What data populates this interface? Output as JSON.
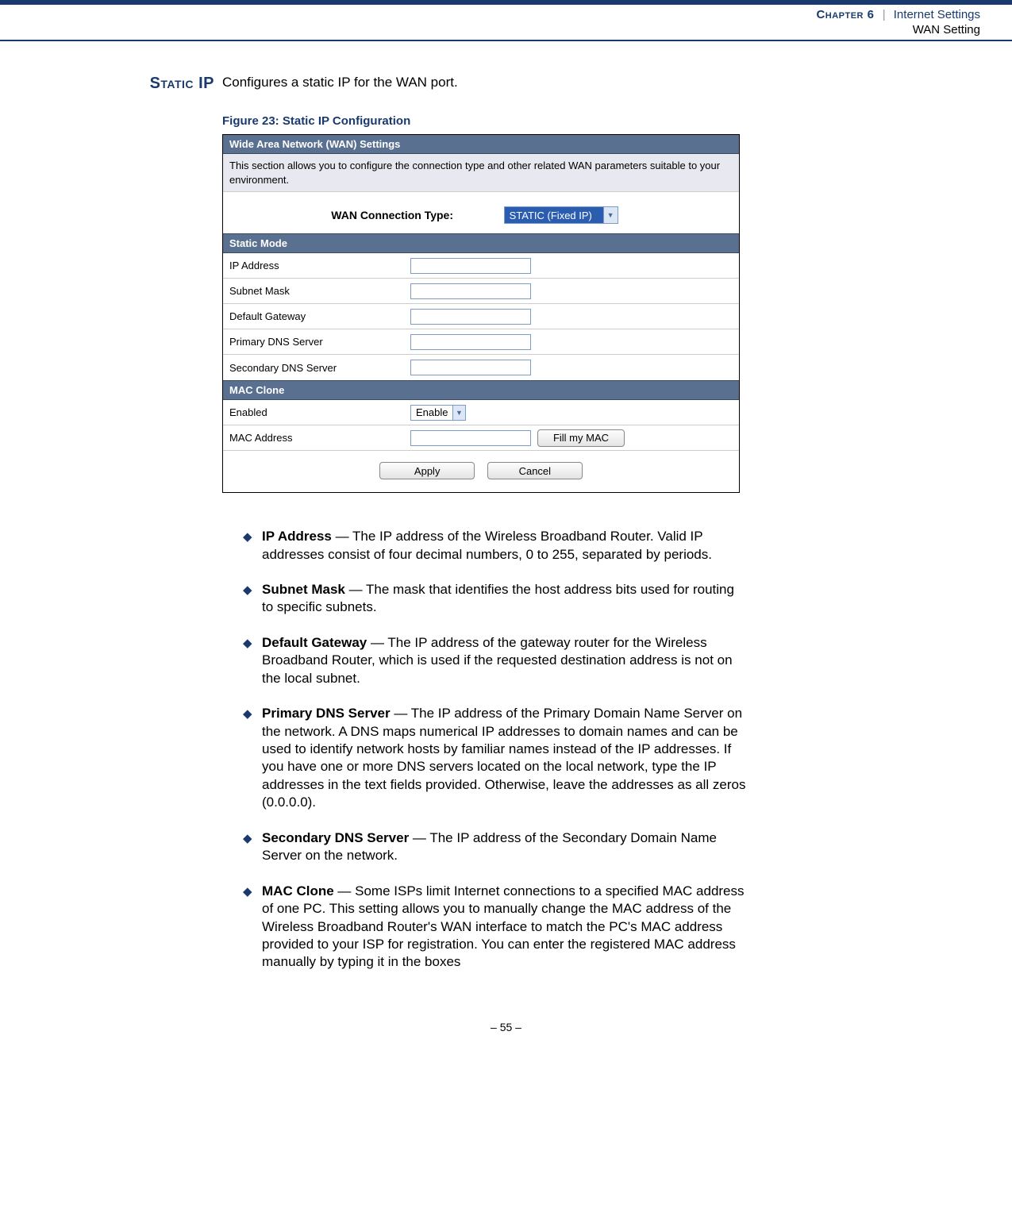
{
  "header": {
    "chapter": "Chapter 6",
    "separator": "|",
    "title": "Internet Settings",
    "subtitle": "WAN Setting"
  },
  "section": {
    "label": "Static IP",
    "lead": "Configures a static IP for the WAN port."
  },
  "figure": {
    "caption": "Figure 23:  Static IP Configuration",
    "panel_title": "Wide Area Network (WAN) Settings",
    "panel_desc": "This section allows you to configure the connection type and other related WAN parameters suitable to your environment.",
    "conn_label": "WAN Connection Type:",
    "conn_value": "STATIC (Fixed IP)",
    "static_mode_header": "Static Mode",
    "rows": {
      "ip_address": "IP Address",
      "subnet_mask": "Subnet Mask",
      "default_gateway": "Default Gateway",
      "primary_dns": "Primary DNS Server",
      "secondary_dns": "Secondary DNS Server"
    },
    "mac_clone_header": "MAC Clone",
    "mac_enabled_label": "Enabled",
    "mac_enabled_value": "Enable",
    "mac_address_label": "MAC Address",
    "fill_my_mac": "Fill my MAC",
    "apply": "Apply",
    "cancel": "Cancel"
  },
  "bullets": [
    {
      "term": "IP Address",
      "desc": " — The IP address of the Wireless Broadband Router. Valid IP addresses consist of four decimal numbers, 0 to 255, separated by periods."
    },
    {
      "term": "Subnet Mask",
      "desc": " — The mask that identifies the host address bits used for routing to specific subnets."
    },
    {
      "term": "Default Gateway",
      "desc": " — The IP address of the gateway router for the Wireless Broadband Router, which is used if the requested destination address is not on the local subnet."
    },
    {
      "term": "Primary DNS Server",
      "desc": " — The IP address of the Primary Domain Name Server on the network. A DNS maps numerical IP addresses to domain names and can be used to identify network hosts by familiar names instead of the IP addresses. If you have one or more DNS servers located on the local network, type the IP addresses in the text fields provided. Otherwise, leave the addresses as all zeros (0.0.0.0)."
    },
    {
      "term": "Secondary DNS Server",
      "desc": " — The IP address of the Secondary Domain Name Server on the network."
    },
    {
      "term": "MAC Clone",
      "desc": " — Some ISPs limit Internet connections to a specified MAC address of one PC. This setting allows you to manually change the MAC address of the Wireless Broadband Router's WAN interface to match the PC's MAC address provided to your ISP for registration. You can enter the registered MAC address manually by typing it in the boxes"
    }
  ],
  "footer": {
    "page": "–  55  –"
  }
}
